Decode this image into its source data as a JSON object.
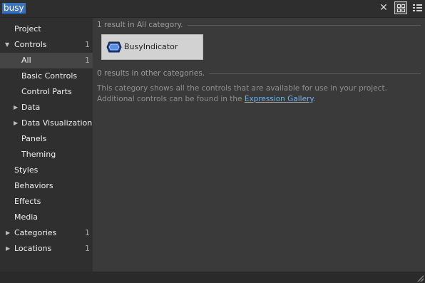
{
  "search": {
    "query": "busy"
  },
  "sidebar": {
    "items": [
      {
        "label": "Project",
        "count": ""
      },
      {
        "label": "Controls",
        "count": "1"
      },
      {
        "label": "All",
        "count": "1"
      },
      {
        "label": "Basic Controls",
        "count": ""
      },
      {
        "label": "Control Parts",
        "count": ""
      },
      {
        "label": "Data",
        "count": ""
      },
      {
        "label": "Data Visualization",
        "count": ""
      },
      {
        "label": "Panels",
        "count": ""
      },
      {
        "label": "Theming",
        "count": ""
      },
      {
        "label": "Styles",
        "count": ""
      },
      {
        "label": "Behaviors",
        "count": ""
      },
      {
        "label": "Effects",
        "count": ""
      },
      {
        "label": "Media",
        "count": ""
      },
      {
        "label": "Categories",
        "count": "1"
      },
      {
        "label": "Locations",
        "count": "1"
      }
    ]
  },
  "results": {
    "header": "1 result in All category.",
    "item_label": "BusyIndicator",
    "other_header": "0 results in other categories.",
    "info_text": "This category shows all the controls that are available for use in your project. Additional controls can be found in the ",
    "link_text": "Expression Gallery",
    "info_end": "."
  },
  "icons": {
    "clear": "close-icon",
    "grid_view": "grid-view-icon",
    "list_view": "list-view-icon",
    "control": "busy-indicator-control-icon"
  },
  "colors": {
    "selection": "#3b71b7",
    "link": "#71b1ee",
    "background": "#3a3a3a",
    "sidebar": "#2f2f2f"
  }
}
